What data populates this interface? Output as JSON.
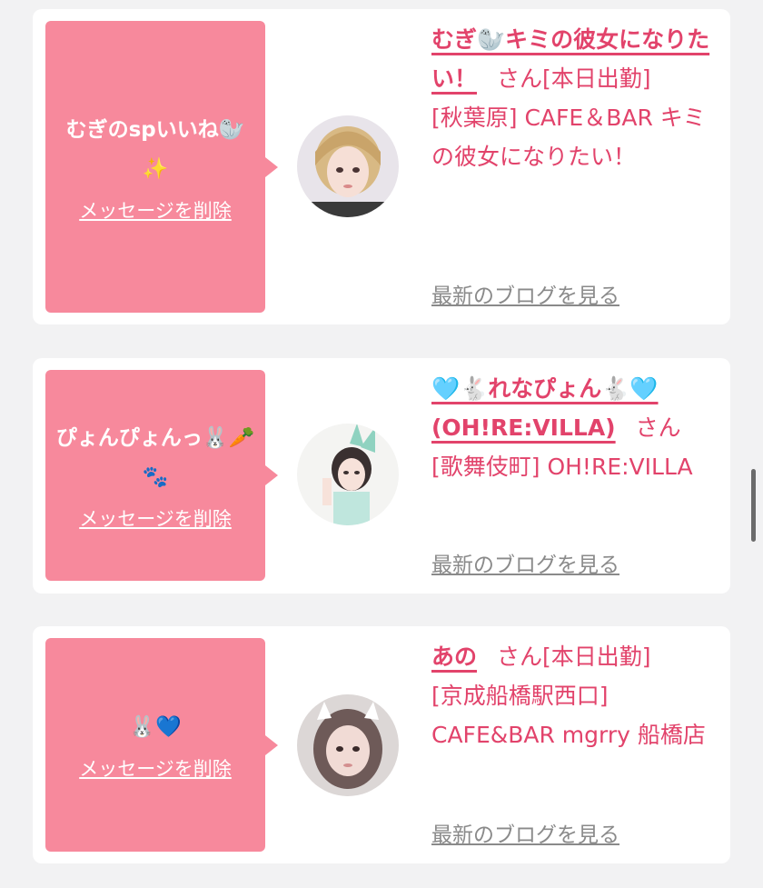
{
  "cards": [
    {
      "message": "むぎのspいいね🦭✨",
      "delete_label": "メッセージを削除",
      "name": "むぎ🦭キミの彼女になりたい！",
      "suffix": "さん[本日出勤]",
      "shop": "[秋葉原] CAFE＆BAR キミの彼女になりたい！",
      "blog_label": "最新のブログを見る"
    },
    {
      "message": "ぴょんぴょんっ🐰🥕🐾",
      "delete_label": "メッセージを削除",
      "name": "🩵🐇れなぴょん🐇🩵(OH!RE:VILLA)",
      "suffix": "さん",
      "shop": "[歌舞伎町] OH!RE:VILLA",
      "blog_label": "最新のブログを見る"
    },
    {
      "message": "🐰💙",
      "delete_label": "メッセージを削除",
      "name": "あの",
      "suffix": "さん[本日出勤]",
      "shop": "[京成船橋駅西口] CAFE&BAR mgrry 船橋店",
      "blog_label": "最新のブログを見る"
    }
  ],
  "colors": {
    "accent": "#e2436b",
    "bubble": "#f7899c",
    "background": "#f2f2f3"
  }
}
